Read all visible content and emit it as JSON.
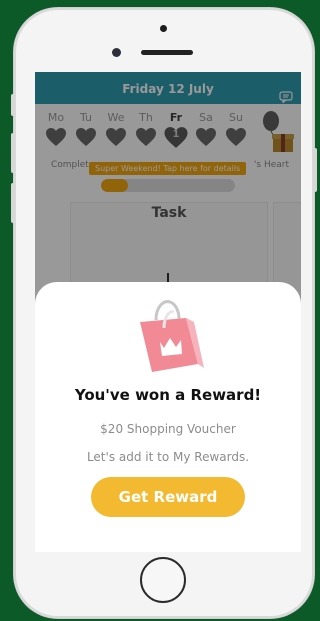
{
  "header": {
    "date": "Friday 12 July",
    "icon": "chat-bubble-icon",
    "color": "#2e9bb0"
  },
  "week": [
    {
      "label": "Mo",
      "badge": ""
    },
    {
      "label": "Tu",
      "badge": ""
    },
    {
      "label": "We",
      "badge": ""
    },
    {
      "label": "Th",
      "badge": ""
    },
    {
      "label": "Fr",
      "badge": "1",
      "current": true
    },
    {
      "label": "Sa",
      "badge": ""
    },
    {
      "label": "Su",
      "badge": ""
    }
  ],
  "streak": {
    "left_label": "Complet",
    "right_label": "'s Heart",
    "promo": "Super Weekend! Tap here for details",
    "progress": 0.2,
    "accent": "#f3a712"
  },
  "task": {
    "title": "Task"
  },
  "reward_popup": {
    "title": "You've won a Reward!",
    "voucher": "$20 Shopping Voucher",
    "message": "Let's add it to My Rewards.",
    "button": "Get Reward",
    "button_color": "#f3b931"
  }
}
